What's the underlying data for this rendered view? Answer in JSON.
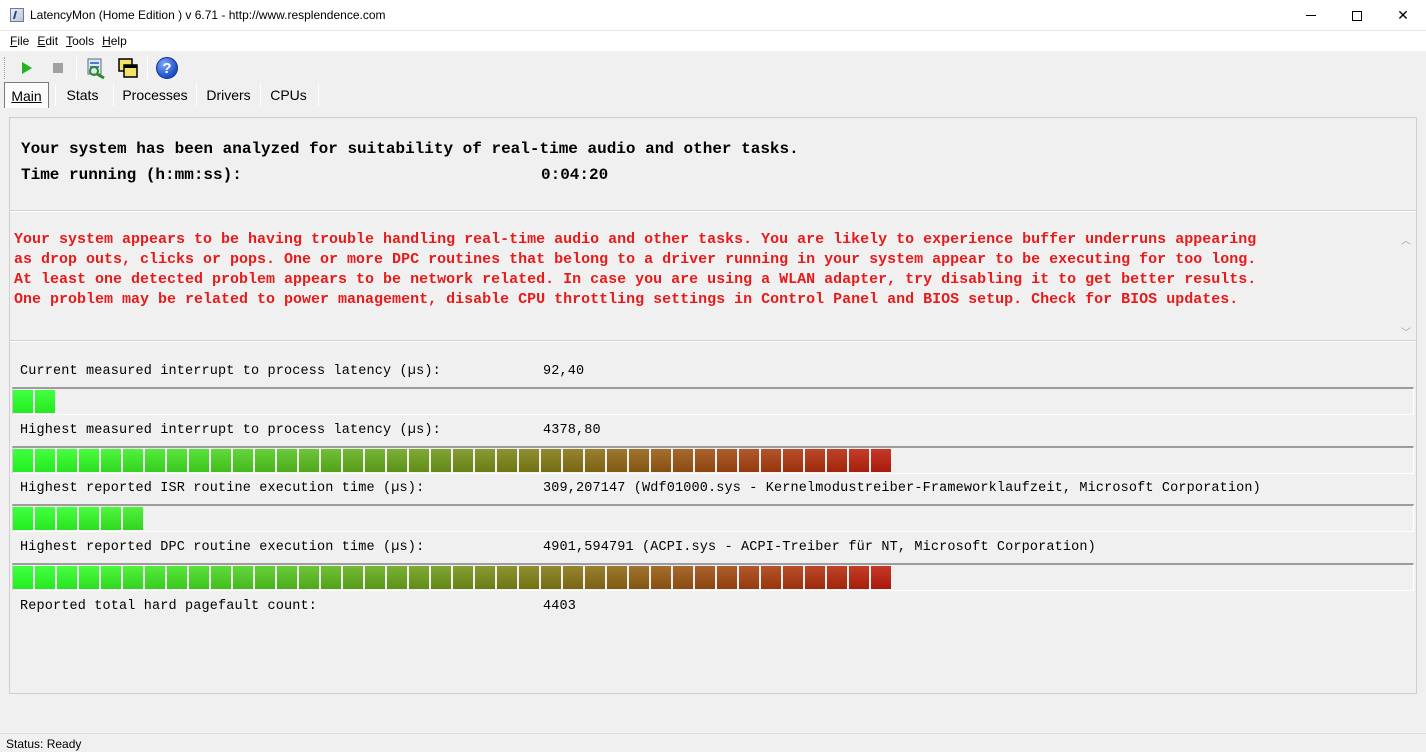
{
  "window": {
    "title": "LatencyMon  (Home Edition )  v 6.71 - http://www.resplendence.com",
    "minimize_icon": "minimize-icon",
    "maximize_icon": "maximize-icon",
    "close_icon": "close-icon",
    "close_glyph": "✕"
  },
  "menu": {
    "items": [
      {
        "first": "F",
        "rest": "ile"
      },
      {
        "first": "E",
        "rest": "dit"
      },
      {
        "first": "T",
        "rest": "ools"
      },
      {
        "first": "H",
        "rest": "elp"
      }
    ]
  },
  "toolbar": {
    "icons": [
      "play-icon",
      "stop-icon",
      "analyze-icon",
      "windows-icon",
      "help-icon"
    ],
    "help_glyph": "?"
  },
  "tabs": [
    {
      "label": "Main",
      "active": true
    },
    {
      "label": "Stats"
    },
    {
      "label": "Processes"
    },
    {
      "label": "Drivers"
    },
    {
      "label": "CPUs"
    }
  ],
  "summary": {
    "line1": "Your system has been analyzed for suitability of real-time audio and other tasks.",
    "time_label": "Time running (h:mm:ss):",
    "time_value": "0:04:20"
  },
  "warning": {
    "text": "Your system appears to be having trouble handling real-time audio and other tasks. You are likely to experience buffer underruns appearing\nas drop outs, clicks or pops. One or more DPC routines that belong to a driver running in your system appear to be executing for too long.\nAt least one detected problem appears to be network related. In case you are using a WLAN adapter, try disabling it to get better results.\nOne problem may be related to power management, disable CPU throttling settings in Control Panel and BIOS setup. Check for BIOS updates.",
    "color": "#e81a1a",
    "scroll_up_glyph": "︿",
    "scroll_down_glyph": "﹀"
  },
  "metrics": {
    "current_latency": {
      "label": "Current measured interrupt to process latency (µs):",
      "value": "92,40",
      "segments": 2
    },
    "highest_latency": {
      "label": "Highest measured interrupt to process latency (µs):",
      "value": "4378,80",
      "segments": 40
    },
    "isr": {
      "label": "Highest reported ISR routine execution time (µs):",
      "value": "309,207147",
      "detail": "(Wdf01000.sys - Kernelmodustreiber-Frameworklaufzeit, Microsoft Corporation)",
      "segments": 6
    },
    "dpc": {
      "label": "Highest reported DPC routine execution time (µs):",
      "value": "4901,594791",
      "detail": "(ACPI.sys - ACPI-Treiber für NT, Microsoft Corporation)",
      "segments": 40
    },
    "pagefault": {
      "label": "Reported total hard pagefault count:",
      "value": "4403"
    },
    "colors": {
      "green": "#22ee22",
      "red": "#a81a0a"
    }
  },
  "status": {
    "text": "Status: Ready"
  }
}
